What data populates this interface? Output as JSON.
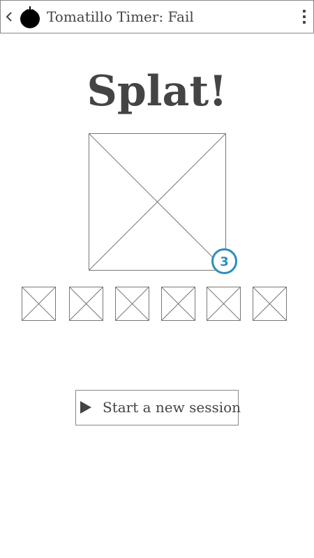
{
  "header": {
    "title": "Tomatillo Timer: Fail",
    "back_icon": "chevron-left-icon",
    "logo_icon": "tomato-icon",
    "menu_icon": "vertical-ellipsis-icon"
  },
  "main": {
    "heading": "Splat!",
    "image_placeholder": "image-placeholder",
    "badge_count": "3",
    "thumbnail_count": 6
  },
  "action": {
    "start_label": "Start a new session",
    "start_icon": "play-icon"
  },
  "colors": {
    "text": "#444444",
    "border": "#888888",
    "badge": "#2a8fb8",
    "background": "#ffffff"
  }
}
